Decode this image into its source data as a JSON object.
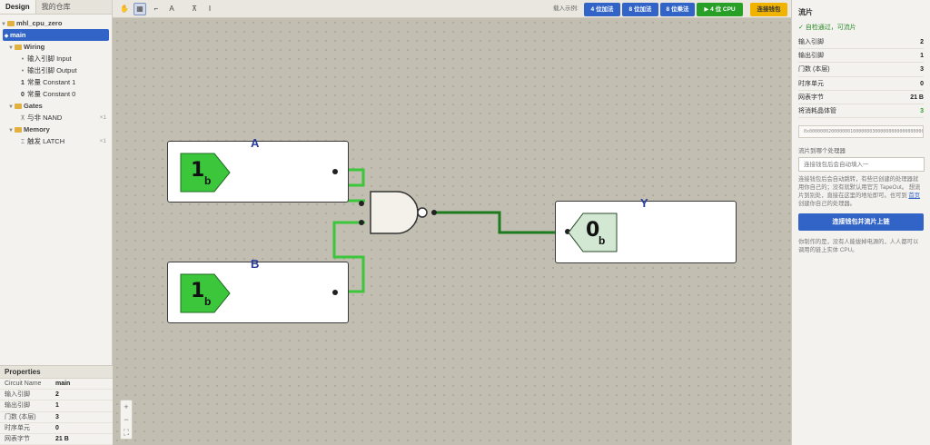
{
  "tabs": {
    "design": "Design",
    "library": "我的仓库"
  },
  "tree": {
    "project": "mhl_cpu_zero",
    "main": "main",
    "wiring": "Wiring",
    "input": "输入引脚 Input",
    "output": "输出引脚 Output",
    "const1": "常量 Constant 1",
    "const0": "常量 Constant 0",
    "const1_icon": "1",
    "const0_icon": "0",
    "gates": "Gates",
    "nand": "与非 NAND",
    "nand_count": "×1",
    "memory": "Memory",
    "latch": "触发 LATCH",
    "latch_count": "×1"
  },
  "properties": {
    "title": "Properties",
    "rows": [
      {
        "k": "Circuit Name",
        "v": "main"
      },
      {
        "k": "输入引脚",
        "v": "2"
      },
      {
        "k": "输出引脚",
        "v": "1"
      },
      {
        "k": "门数 (本层)",
        "v": "3"
      },
      {
        "k": "时序单元",
        "v": "0"
      },
      {
        "k": "网表字节",
        "v": "21 B"
      }
    ]
  },
  "toolbar": {
    "load_label": "载入示例:",
    "b1": "4 位加法",
    "b2": "8 位加法",
    "b3": "8 位乘法",
    "b4": "▶ 4 位 CPU",
    "b5": "连接钱包"
  },
  "circuit": {
    "a_label": "A",
    "b_label": "B",
    "y_label": "Y",
    "a_value": "1",
    "b_value": "1",
    "y_value": "0",
    "sub": "b",
    "colors": {
      "wire_on": "#3cc63c",
      "wire_off": "#1e7a1e",
      "pin_on": "#3cc63c",
      "pin_off": "#d2e8d2",
      "label": "#2a3c9e"
    }
  },
  "zoom": {
    "in": "+",
    "out": "−",
    "fit": "⛶"
  },
  "right": {
    "title": "流片",
    "status": "✓ 自检通过，可流片",
    "rows": [
      {
        "k": "输入引脚",
        "v": "2"
      },
      {
        "k": "输出引脚",
        "v": "1"
      },
      {
        "k": "门数 (本层)",
        "v": "3"
      },
      {
        "k": "时序单元",
        "v": "0"
      },
      {
        "k": "网表字节",
        "v": "21 B"
      },
      {
        "k": "将消耗晶体管",
        "v": "3"
      }
    ],
    "hex": "0x000000020000000100000003000000000000000000000015",
    "sub_label": "流片到哪个处理器",
    "input_placeholder": "连接钱包后会自动填入一",
    "note1_a": "连接钱包后会自动跳转，有些已创建的处理器就用你自己的；没有就默认用官方 TapeOut。 想流片到别处，直接在这里的地址即可。也可到 ",
    "note1_link": "首页",
    "note1_b": " 创建你自己的处理器。",
    "tapeout_btn": "连接钱包并流片上链",
    "note2": "你制作的是，没有人能拔掉电源的，人人都可以调用的链上实体 CPU。"
  }
}
